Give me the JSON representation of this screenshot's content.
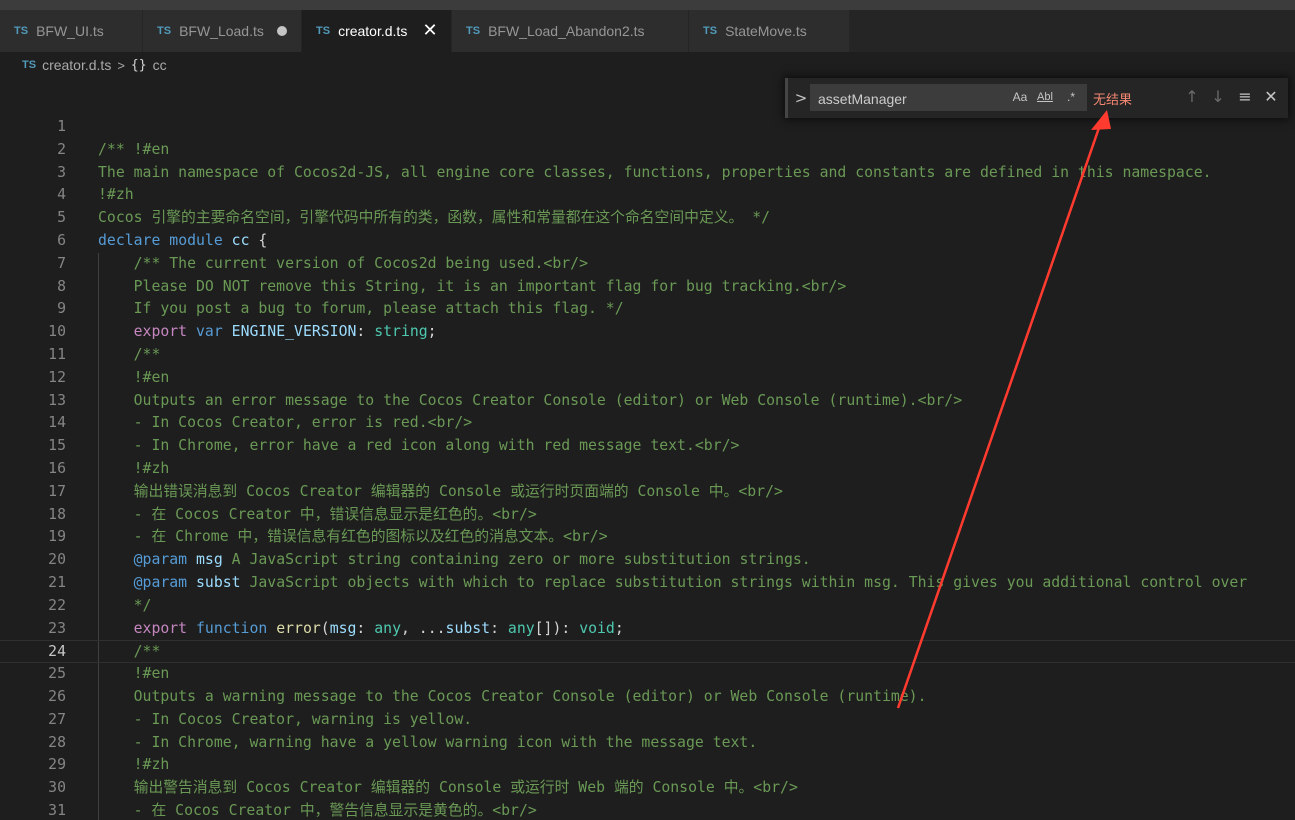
{
  "tabs": [
    {
      "badge": "TS",
      "label": "BFW_UI.ts",
      "active": false,
      "dirty": false
    },
    {
      "badge": "TS",
      "label": "BFW_Load.ts",
      "active": false,
      "dirty": true
    },
    {
      "badge": "TS",
      "label": "creator.d.ts",
      "active": true,
      "dirty": false,
      "close": "✕"
    },
    {
      "badge": "TS",
      "label": "BFW_Load_Abandon2.ts",
      "active": false,
      "dirty": false
    },
    {
      "badge": "TS",
      "label": "StateMove.ts",
      "active": false,
      "dirty": false
    }
  ],
  "breadcrumb": {
    "badge": "TS",
    "file": "creator.d.ts",
    "separator": ">",
    "symbol_icon": "{}",
    "symbol": "cc"
  },
  "find": {
    "toggle": ">",
    "query": "assetManager",
    "match_case": "Aa",
    "whole_word": "Abl",
    "regex": ".*",
    "result": "无结果",
    "prev": "↑",
    "next": "↓",
    "selection": "≡",
    "close": "✕"
  },
  "editor": {
    "current_line": 24,
    "lines": [
      {
        "n": "1",
        "tokens": []
      },
      {
        "n": "2",
        "tokens": [
          {
            "t": "c",
            "v": "/** !#en"
          }
        ]
      },
      {
        "n": "3",
        "tokens": [
          {
            "t": "c",
            "v": "The main namespace of Cocos2d-JS, all engine core classes, functions, properties and constants are defined in this namespace."
          }
        ]
      },
      {
        "n": "4",
        "tokens": [
          {
            "t": "c",
            "v": "!#zh"
          }
        ]
      },
      {
        "n": "5",
        "tokens": [
          {
            "t": "c",
            "v": "Cocos 引擎的主要命名空间，引擎代码中所有的类，函数，属性和常量都在这个命名空间中定义。 */"
          }
        ]
      },
      {
        "n": "6",
        "tokens": [
          {
            "t": "k",
            "v": "declare"
          },
          {
            "t": "p",
            "v": " "
          },
          {
            "t": "k",
            "v": "module"
          },
          {
            "t": "p",
            "v": " "
          },
          {
            "t": "i",
            "v": "cc"
          },
          {
            "t": "p",
            "v": " {"
          }
        ]
      },
      {
        "n": "7",
        "tokens": [
          {
            "t": "p",
            "v": "    "
          },
          {
            "t": "c",
            "v": "/** The current version of Cocos2d being used.<br/>"
          }
        ]
      },
      {
        "n": "8",
        "tokens": [
          {
            "t": "p",
            "v": "    "
          },
          {
            "t": "c",
            "v": "Please DO NOT remove this String, it is an important flag for bug tracking.<br/>"
          }
        ]
      },
      {
        "n": "9",
        "tokens": [
          {
            "t": "p",
            "v": "    "
          },
          {
            "t": "c",
            "v": "If you post a bug to forum, please attach this flag. */"
          }
        ]
      },
      {
        "n": "10",
        "tokens": [
          {
            "t": "p",
            "v": "    "
          },
          {
            "t": "x",
            "v": "export"
          },
          {
            "t": "p",
            "v": " "
          },
          {
            "t": "k",
            "v": "var"
          },
          {
            "t": "p",
            "v": " "
          },
          {
            "t": "i",
            "v": "ENGINE_VERSION"
          },
          {
            "t": "p",
            "v": ": "
          },
          {
            "t": "y",
            "v": "string"
          },
          {
            "t": "p",
            "v": ";"
          }
        ]
      },
      {
        "n": "11",
        "tokens": [
          {
            "t": "p",
            "v": "    "
          },
          {
            "t": "c",
            "v": "/**"
          }
        ]
      },
      {
        "n": "12",
        "tokens": [
          {
            "t": "p",
            "v": "    "
          },
          {
            "t": "c",
            "v": "!#en"
          }
        ]
      },
      {
        "n": "13",
        "tokens": [
          {
            "t": "p",
            "v": "    "
          },
          {
            "t": "c",
            "v": "Outputs an error message to the Cocos Creator Console (editor) or Web Console (runtime).<br/>"
          }
        ]
      },
      {
        "n": "14",
        "tokens": [
          {
            "t": "p",
            "v": "    "
          },
          {
            "t": "c",
            "v": "- In Cocos Creator, error is red.<br/>"
          }
        ]
      },
      {
        "n": "15",
        "tokens": [
          {
            "t": "p",
            "v": "    "
          },
          {
            "t": "c",
            "v": "- In Chrome, error have a red icon along with red message text.<br/>"
          }
        ]
      },
      {
        "n": "16",
        "tokens": [
          {
            "t": "p",
            "v": "    "
          },
          {
            "t": "c",
            "v": "!#zh"
          }
        ]
      },
      {
        "n": "17",
        "tokens": [
          {
            "t": "p",
            "v": "    "
          },
          {
            "t": "c",
            "v": "输出错误消息到 Cocos Creator 编辑器的 Console 或运行时页面端的 Console 中。<br/>"
          }
        ]
      },
      {
        "n": "18",
        "tokens": [
          {
            "t": "p",
            "v": "    "
          },
          {
            "t": "c",
            "v": "- 在 Cocos Creator 中，错误信息显示是红色的。<br/>"
          }
        ]
      },
      {
        "n": "19",
        "tokens": [
          {
            "t": "p",
            "v": "    "
          },
          {
            "t": "c",
            "v": "- 在 Chrome 中，错误信息有红色的图标以及红色的消息文本。<br/>"
          }
        ]
      },
      {
        "n": "20",
        "tokens": [
          {
            "t": "p",
            "v": "    "
          },
          {
            "t": "g",
            "v": "@param"
          },
          {
            "t": "p",
            "v": " "
          },
          {
            "t": "i",
            "v": "msg"
          },
          {
            "t": "c",
            "v": " A JavaScript string containing zero or more substitution strings."
          }
        ]
      },
      {
        "n": "21",
        "tokens": [
          {
            "t": "p",
            "v": "    "
          },
          {
            "t": "g",
            "v": "@param"
          },
          {
            "t": "p",
            "v": " "
          },
          {
            "t": "i",
            "v": "subst"
          },
          {
            "t": "c",
            "v": " JavaScript objects with which to replace substitution strings within msg. This gives you additional control over"
          }
        ]
      },
      {
        "n": "22",
        "tokens": [
          {
            "t": "p",
            "v": "    "
          },
          {
            "t": "c",
            "v": "*/"
          }
        ]
      },
      {
        "n": "23",
        "tokens": [
          {
            "t": "p",
            "v": "    "
          },
          {
            "t": "x",
            "v": "export"
          },
          {
            "t": "p",
            "v": " "
          },
          {
            "t": "k",
            "v": "function"
          },
          {
            "t": "p",
            "v": " "
          },
          {
            "t": "f",
            "v": "error"
          },
          {
            "t": "p",
            "v": "("
          },
          {
            "t": "i",
            "v": "msg"
          },
          {
            "t": "p",
            "v": ": "
          },
          {
            "t": "y",
            "v": "any"
          },
          {
            "t": "p",
            "v": ", ..."
          },
          {
            "t": "i",
            "v": "subst"
          },
          {
            "t": "p",
            "v": ": "
          },
          {
            "t": "y",
            "v": "any"
          },
          {
            "t": "p",
            "v": "[]): "
          },
          {
            "t": "y",
            "v": "void"
          },
          {
            "t": "p",
            "v": ";"
          }
        ]
      },
      {
        "n": "24",
        "tokens": [
          {
            "t": "p",
            "v": "    "
          },
          {
            "t": "c",
            "v": "/**"
          }
        ]
      },
      {
        "n": "25",
        "tokens": [
          {
            "t": "p",
            "v": "    "
          },
          {
            "t": "c",
            "v": "!#en"
          }
        ]
      },
      {
        "n": "26",
        "tokens": [
          {
            "t": "p",
            "v": "    "
          },
          {
            "t": "c",
            "v": "Outputs a warning message to the Cocos Creator Console (editor) or Web Console (runtime)."
          }
        ]
      },
      {
        "n": "27",
        "tokens": [
          {
            "t": "p",
            "v": "    "
          },
          {
            "t": "c",
            "v": "- In Cocos Creator, warning is yellow."
          }
        ]
      },
      {
        "n": "28",
        "tokens": [
          {
            "t": "p",
            "v": "    "
          },
          {
            "t": "c",
            "v": "- In Chrome, warning have a yellow warning icon with the message text."
          }
        ]
      },
      {
        "n": "29",
        "tokens": [
          {
            "t": "p",
            "v": "    "
          },
          {
            "t": "c",
            "v": "!#zh"
          }
        ]
      },
      {
        "n": "30",
        "tokens": [
          {
            "t": "p",
            "v": "    "
          },
          {
            "t": "c",
            "v": "输出警告消息到 Cocos Creator 编辑器的 Console 或运行时 Web 端的 Console 中。<br/>"
          }
        ]
      },
      {
        "n": "31",
        "tokens": [
          {
            "t": "p",
            "v": "    "
          },
          {
            "t": "c",
            "v": "- 在 Cocos Creator 中，警告信息显示是黄色的。<br/>"
          }
        ]
      }
    ]
  },
  "colors": {
    "editor_bg": "#1e1e1e",
    "comment": "#6a9955",
    "keyword": "#569cd6",
    "control_keyword": "#c586c0",
    "identifier": "#9cdcfe",
    "type": "#4ec9b0",
    "function": "#dcdcaa",
    "no_results": "#f48771",
    "annotation_arrow": "#ff3b30"
  }
}
